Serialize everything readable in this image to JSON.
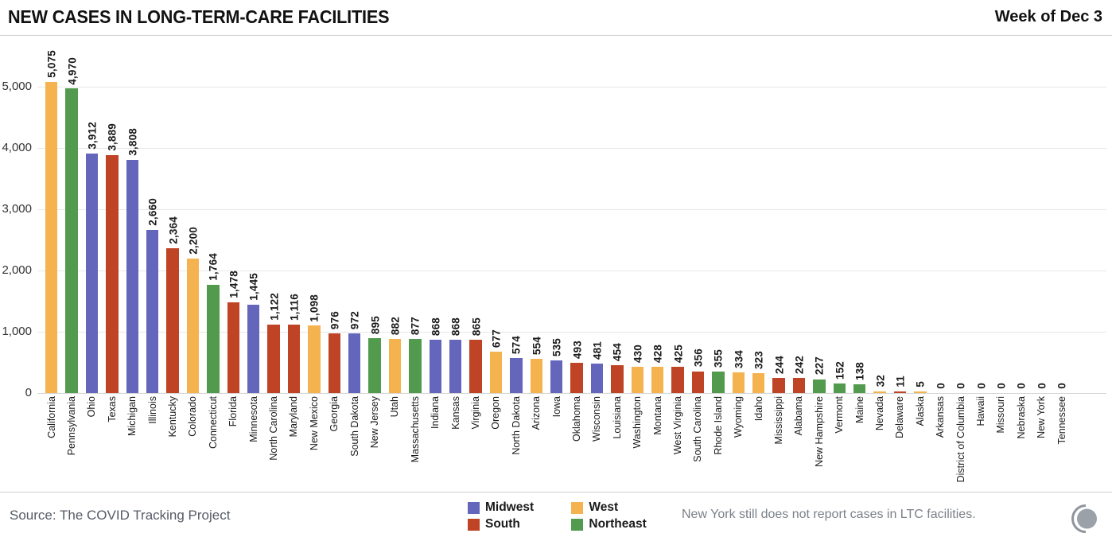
{
  "header": {
    "title": "NEW CASES IN LONG-TERM-CARE FACILITIES",
    "week_label": "Week of Dec 3"
  },
  "footer": {
    "source": "Source: The COVID Tracking Project",
    "note": "New York still does not report cases in LTC facilities.",
    "logo_icon": "covid-tracking-project-logo"
  },
  "legend": {
    "items": [
      {
        "label": "Midwest",
        "color": "#6366ba"
      },
      {
        "label": "West",
        "color": "#f5b350"
      },
      {
        "label": "South",
        "color": "#bf4425"
      },
      {
        "label": "Northeast",
        "color": "#529b4e"
      }
    ]
  },
  "colors": {
    "midwest": "#6366ba",
    "west": "#f5b350",
    "south": "#bf4425",
    "northeast": "#529b4e",
    "grid": "#e8e8e8",
    "text": "#1a1a1a"
  },
  "chart_data": {
    "type": "bar",
    "title": "NEW CASES IN LONG-TERM-CARE FACILITIES",
    "subtitle": "Week of Dec 3",
    "xlabel": "",
    "ylabel": "",
    "ylim": [
      0,
      5200
    ],
    "yticks": [
      0,
      1000,
      2000,
      3000,
      4000,
      5000
    ],
    "ytick_labels": [
      "0",
      "1,000",
      "2,000",
      "3,000",
      "4,000",
      "5,000"
    ],
    "grid": true,
    "legend_position": "bottom-center",
    "value_labels": true,
    "categories": [
      "California",
      "Pennsylvania",
      "Ohio",
      "Texas",
      "Michigan",
      "Illinois",
      "Kentucky",
      "Colorado",
      "Connecticut",
      "Florida",
      "Minnesota",
      "North Carolina",
      "Maryland",
      "New Mexico",
      "Georgia",
      "South Dakota",
      "New Jersey",
      "Utah",
      "Massachusetts",
      "Indiana",
      "Kansas",
      "Virginia",
      "Oregon",
      "North Dakota",
      "Arizona",
      "Iowa",
      "Oklahoma",
      "Wisconsin",
      "Louisiana",
      "Washington",
      "Montana",
      "West Virginia",
      "South Carolina",
      "Rhode Island",
      "Wyoming",
      "Idaho",
      "Mississippi",
      "Alabama",
      "New Hampshire",
      "Vermont",
      "Maine",
      "Nevada",
      "Delaware",
      "Alaska",
      "Arkansas",
      "District of Columbia",
      "Hawaii",
      "Missouri",
      "Nebraska",
      "New York",
      "Tennessee"
    ],
    "values": [
      5075,
      4970,
      3912,
      3889,
      3808,
      2660,
      2364,
      2200,
      1764,
      1478,
      1445,
      1122,
      1116,
      1098,
      976,
      972,
      895,
      882,
      877,
      868,
      868,
      865,
      677,
      574,
      554,
      535,
      493,
      481,
      454,
      430,
      428,
      425,
      356,
      355,
      334,
      323,
      244,
      242,
      227,
      152,
      138,
      32,
      11,
      5,
      0,
      0,
      0,
      0,
      0,
      0,
      0
    ],
    "value_labels_text": [
      "5,075",
      "4,970",
      "3,912",
      "3,889",
      "3,808",
      "2,660",
      "2,364",
      "2,200",
      "1,764",
      "1,478",
      "1,445",
      "1,122",
      "1,116",
      "1,098",
      "976",
      "972",
      "895",
      "882",
      "877",
      "868",
      "868",
      "865",
      "677",
      "574",
      "554",
      "535",
      "493",
      "481",
      "454",
      "430",
      "428",
      "425",
      "356",
      "355",
      "334",
      "323",
      "244",
      "242",
      "227",
      "152",
      "138",
      "32",
      "11",
      "5",
      "0",
      "0",
      "0",
      "0",
      "0",
      "0",
      "0"
    ],
    "regions": [
      "West",
      "Northeast",
      "Midwest",
      "South",
      "Midwest",
      "Midwest",
      "South",
      "West",
      "Northeast",
      "South",
      "Midwest",
      "South",
      "South",
      "West",
      "South",
      "Midwest",
      "Northeast",
      "West",
      "Northeast",
      "Midwest",
      "Midwest",
      "South",
      "West",
      "Midwest",
      "West",
      "Midwest",
      "South",
      "Midwest",
      "South",
      "West",
      "West",
      "South",
      "South",
      "Northeast",
      "West",
      "West",
      "South",
      "South",
      "Northeast",
      "Northeast",
      "Northeast",
      "West",
      "South",
      "West",
      "South",
      "South",
      "West",
      "Midwest",
      "Midwest",
      "Northeast",
      "South"
    ]
  }
}
